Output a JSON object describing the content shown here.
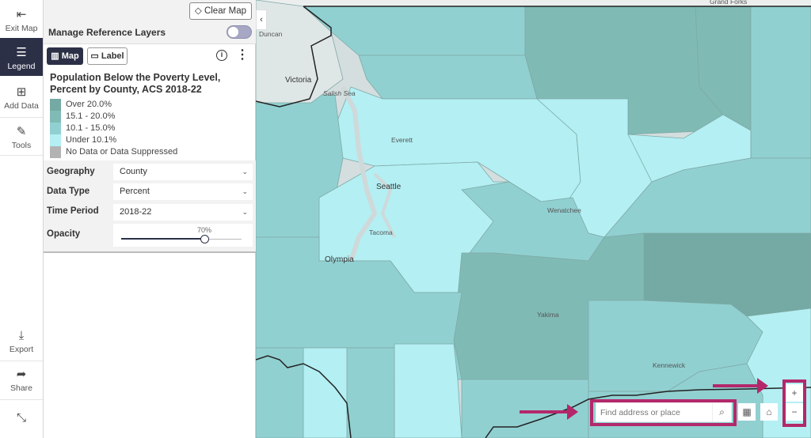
{
  "nav": {
    "items": [
      {
        "label": "Exit Map",
        "icon": "exit-icon"
      },
      {
        "label": "Legend",
        "icon": "list-icon",
        "active": true
      },
      {
        "label": "Add Data",
        "icon": "add-file-icon"
      },
      {
        "label": "Tools",
        "icon": "tools-icon"
      },
      {
        "label": "Export",
        "icon": "download-icon"
      },
      {
        "label": "Share",
        "icon": "share-icon"
      }
    ],
    "collapse_icon": "collapse-arrows-icon"
  },
  "panel": {
    "clear_map_label": "Clear Map",
    "manage_reference_layers_label": "Manage Reference Layers",
    "manage_reference_layers_on": false,
    "tabs": {
      "map": "Map",
      "label": "Label"
    },
    "legend": {
      "title": "Population Below the Poverty Level, Percent by County, ACS 2018-22",
      "classes": [
        {
          "label": "Over 20.0%",
          "color": "#74aaa3"
        },
        {
          "label": "15.1 - 20.0%",
          "color": "#80bab5"
        },
        {
          "label": "10.1 - 15.0%",
          "color": "#91d0d1"
        },
        {
          "label": "Under 10.1%",
          "color": "#b3eff3"
        },
        {
          "label": "No Data or Data Suppressed",
          "color": "#b3b3b3"
        }
      ]
    },
    "form": {
      "geography": {
        "label": "Geography",
        "value": "County"
      },
      "data_type": {
        "label": "Data Type",
        "value": "Percent"
      },
      "time_period": {
        "label": "Time Period",
        "value": "2018-22"
      },
      "opacity": {
        "label": "Opacity",
        "value_text": "70%",
        "value": 0.7
      }
    }
  },
  "map": {
    "cities": [
      {
        "name": "Grand Forks"
      },
      {
        "name": "Duncan"
      },
      {
        "name": "Victoria"
      },
      {
        "name": "Salish Sea"
      },
      {
        "name": "Everett"
      },
      {
        "name": "Seattle"
      },
      {
        "name": "Wenatchee"
      },
      {
        "name": "Tacoma"
      },
      {
        "name": "Olympia"
      },
      {
        "name": "Yakima"
      },
      {
        "name": "Kennewick"
      }
    ],
    "search_placeholder": "Find address or place",
    "zoom_in": "+",
    "zoom_out": "−"
  }
}
